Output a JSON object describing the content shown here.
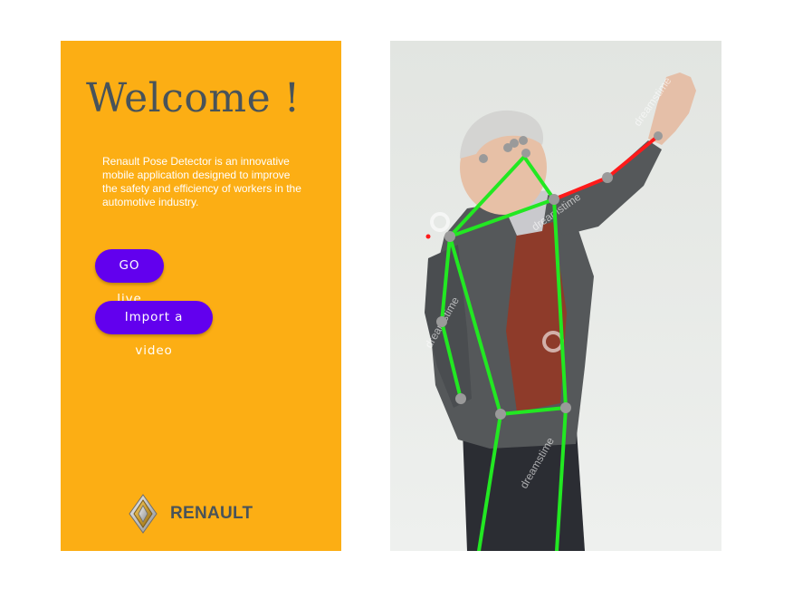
{
  "welcome_screen": {
    "title": "Welcome !",
    "description_lines": [
      "Renault Pose Detector is an innovative",
      " mobile application designed to improve",
      " the safety and efficiency of workers in the",
      "automotive industry."
    ],
    "go_live_label": "GO live",
    "import_video_label": "Import a video",
    "brand_name": "RENAULT",
    "logo_icon": "renault-diamond-icon"
  },
  "pose_view": {
    "watermark_text": "dreamstime",
    "skeleton_color": "#22E822",
    "alert_segment_color": "#FF1A1A",
    "keypoint_color": "#9A9A9A"
  },
  "colors": {
    "background": "#FCAE14",
    "title": "#48535A",
    "button": "#6200EE",
    "button_text": "#FFFFFF"
  }
}
